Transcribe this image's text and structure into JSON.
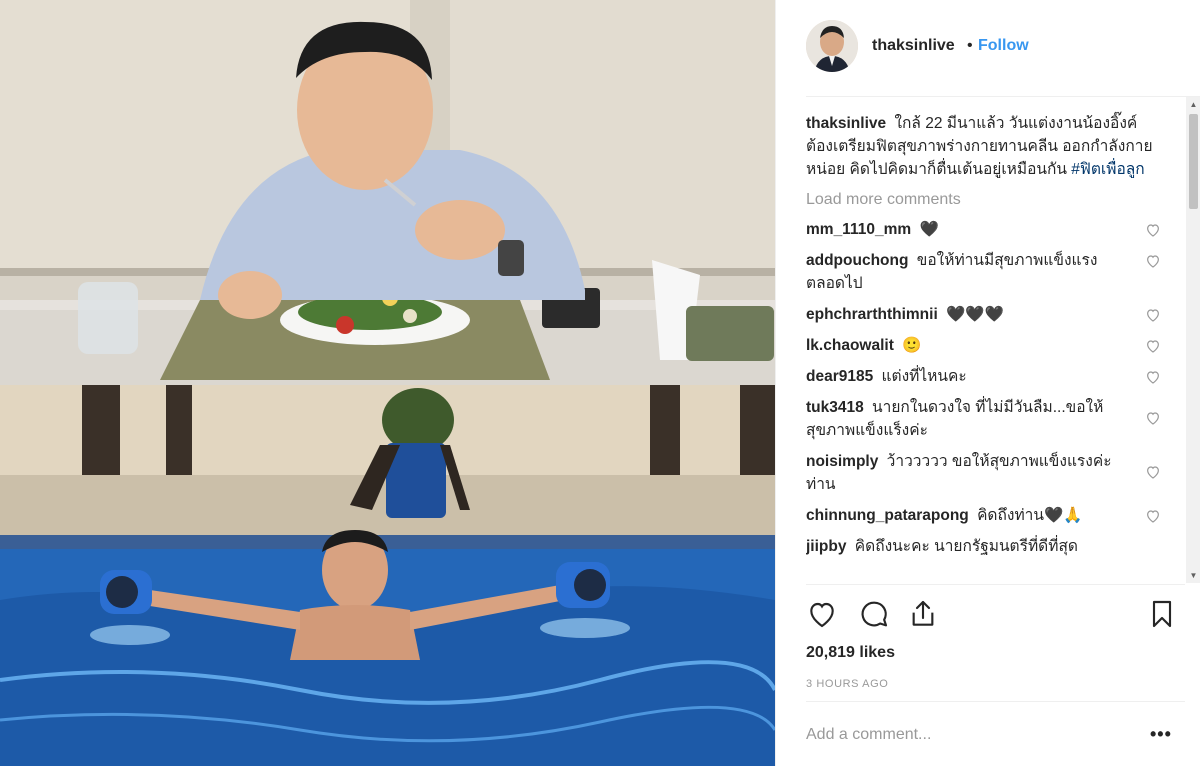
{
  "post": {
    "username": "thaksinlive",
    "separator": "•",
    "follow_label": "Follow",
    "caption_user": "thaksinlive",
    "caption_text": "ใกล้ 22 มีนาแล้ว วันแต่งงานน้องอิ๊งค์ ต้องเตรียมฟิตสุขภาพร่างกายทานคลีน ออกกำลังกายหน่อย คิดไปคิดมาก็ตื่นเต้นอยู่เหมือนกัน",
    "caption_hashtag": "#ฟิตเพื่อลูก",
    "load_more": "Load more comments",
    "likes": "20,819 likes",
    "time": "3 HOURS AGO",
    "add_comment_placeholder": "Add a comment...",
    "more_label": "•••"
  },
  "comments": [
    {
      "user": "mm_1110_mm",
      "text": "🖤"
    },
    {
      "user": "addpouchong",
      "text": "ขอให้ท่านมีสุขภาพแข็งแรงตลอดไป"
    },
    {
      "user": "ephchrarththimnii",
      "text": "🖤🖤🖤"
    },
    {
      "user": "lk.chaowalit",
      "text": "🙂"
    },
    {
      "user": "dear9185",
      "text": "แต่งที่ไหนคะ"
    },
    {
      "user": "tuk3418",
      "text": "นายกในดวงใจ ที่ไม่มีวันลืม...ขอให้สุขภาพแข็งแร็งค่ะ"
    },
    {
      "user": "noisimply",
      "text": "ว้าววววว ขอให้สุขภาพแข็งแรงค่ะท่าน"
    },
    {
      "user": "chinnung_patarapong",
      "text": "คิดถึงท่าน🖤🙏"
    },
    {
      "user": "jiipby",
      "text": "คิดถึงนะคะ นายกรัฐมนตรีที่ดีที่สุด"
    }
  ],
  "icons": {
    "like": "heart-icon",
    "comment": "comment-icon",
    "share": "share-icon",
    "save": "bookmark-icon"
  },
  "colors": {
    "follow": "#3897f0",
    "text": "#262626",
    "muted": "#999999"
  }
}
